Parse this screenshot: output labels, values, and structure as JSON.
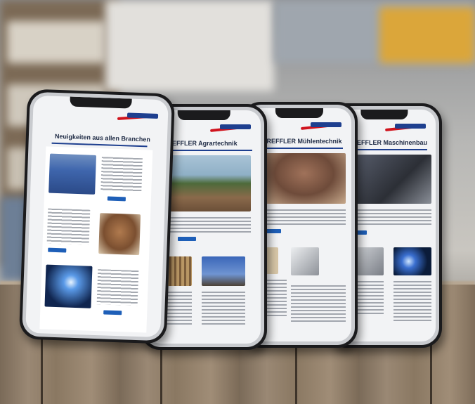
{
  "phones": [
    {
      "heading": "Neuigkeiten aus allen Branchen"
    },
    {
      "heading": "TREFFLER Agrartechnik"
    },
    {
      "heading": "TREFFLER Mühlentechnik"
    },
    {
      "heading": "TREFFLER Maschinenbau"
    }
  ],
  "colors": {
    "brand_blue": "#1e3f8f",
    "brand_red": "#d0131d",
    "button_blue": "#1e5fb8"
  }
}
